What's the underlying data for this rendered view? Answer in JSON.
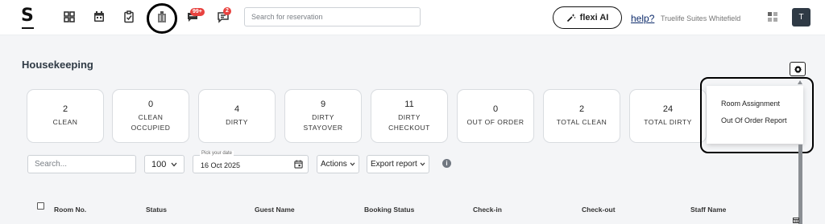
{
  "brand": {
    "logo": "S"
  },
  "nav": {
    "icons": [
      "dashboard-icon",
      "calendar-icon",
      "task-checklist-icon",
      "housekeeping-icon",
      "chat-icon",
      "message-icon"
    ],
    "chat_badge": "99+",
    "message_badge": "2"
  },
  "search": {
    "placeholder": "Search for reservation"
  },
  "flexi": {
    "label": "flexi AI"
  },
  "help": {
    "label": "help?"
  },
  "hotel": {
    "name": "Truelife Suites Whitefield"
  },
  "user": {
    "initial": "T"
  },
  "page": {
    "title": "Housekeeping"
  },
  "cards": [
    {
      "value": "2",
      "label": "CLEAN",
      "label2": ""
    },
    {
      "value": "0",
      "label": "CLEAN",
      "label2": "OCCUPIED"
    },
    {
      "value": "4",
      "label": "DIRTY",
      "label2": ""
    },
    {
      "value": "9",
      "label": "DIRTY",
      "label2": "STAYOVER"
    },
    {
      "value": "11",
      "label": "DIRTY",
      "label2": "CHECKOUT"
    },
    {
      "value": "0",
      "label": "OUT OF ORDER",
      "label2": ""
    },
    {
      "value": "2",
      "label": "TOTAL CLEAN",
      "label2": ""
    },
    {
      "value": "24",
      "label": "TOTAL DIRTY",
      "label2": ""
    }
  ],
  "filters": {
    "search_placeholder": "Search...",
    "per_page": "100",
    "date_label": "Pick your date",
    "date_value": "16 Oct 2025",
    "actions_label": "Actions",
    "export_label": "Export report"
  },
  "table": {
    "headers": [
      "Room No.",
      "Status",
      "Guest Name",
      "Booking Status",
      "Check-in",
      "Check-out",
      "Staff Name"
    ]
  },
  "dropdown": {
    "items": [
      "Room Assignment",
      "Out Of Order Report"
    ]
  }
}
